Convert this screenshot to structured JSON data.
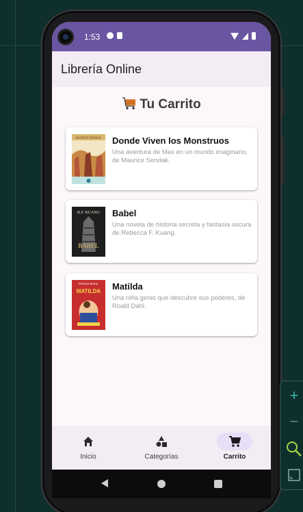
{
  "status_bar": {
    "time": "1:53"
  },
  "app_bar": {
    "title": "Librería Online"
  },
  "page": {
    "title": "Tu Carrito"
  },
  "cart_items": [
    {
      "title": "Donde Viven los Monstruos",
      "description": "Una aventura de Max en un mundo imaginario, de Maurice Sendak.",
      "cover_text_top": "MAURICE SENDAK",
      "cover_colors": [
        "#d9b870",
        "#b5553a",
        "#f2e6c4"
      ]
    },
    {
      "title": "Babel",
      "description": "Una novela de historia secreta y fantasía oscura de Rebecca F. Kuang.",
      "cover_text_top": "R.F. KUANG",
      "cover_text_main": "BABEL",
      "cover_colors": [
        "#1e1e1e",
        "#6a6a6a",
        "#c2a56a"
      ]
    },
    {
      "title": "Matilda",
      "description": "Una niña genio que descubre sus poderes, de Roald Dahl.",
      "cover_text_top": "ROALD DAHL",
      "cover_text_main": "MATILDA",
      "cover_colors": [
        "#c62e2e",
        "#f1d24a",
        "#2e4f9b"
      ]
    }
  ],
  "bottom_nav": [
    {
      "label": "Inicio",
      "icon": "home-icon",
      "active": false
    },
    {
      "label": "Categorías",
      "icon": "category-icon",
      "active": false
    },
    {
      "label": "Carrito",
      "icon": "cart-icon",
      "active": true
    }
  ],
  "colors": {
    "status_bar": "#6a55a2",
    "app_bar": "#f3ecf4",
    "screen_bg": "#fdf6fb",
    "nav_pill_active": "#e8def8"
  }
}
